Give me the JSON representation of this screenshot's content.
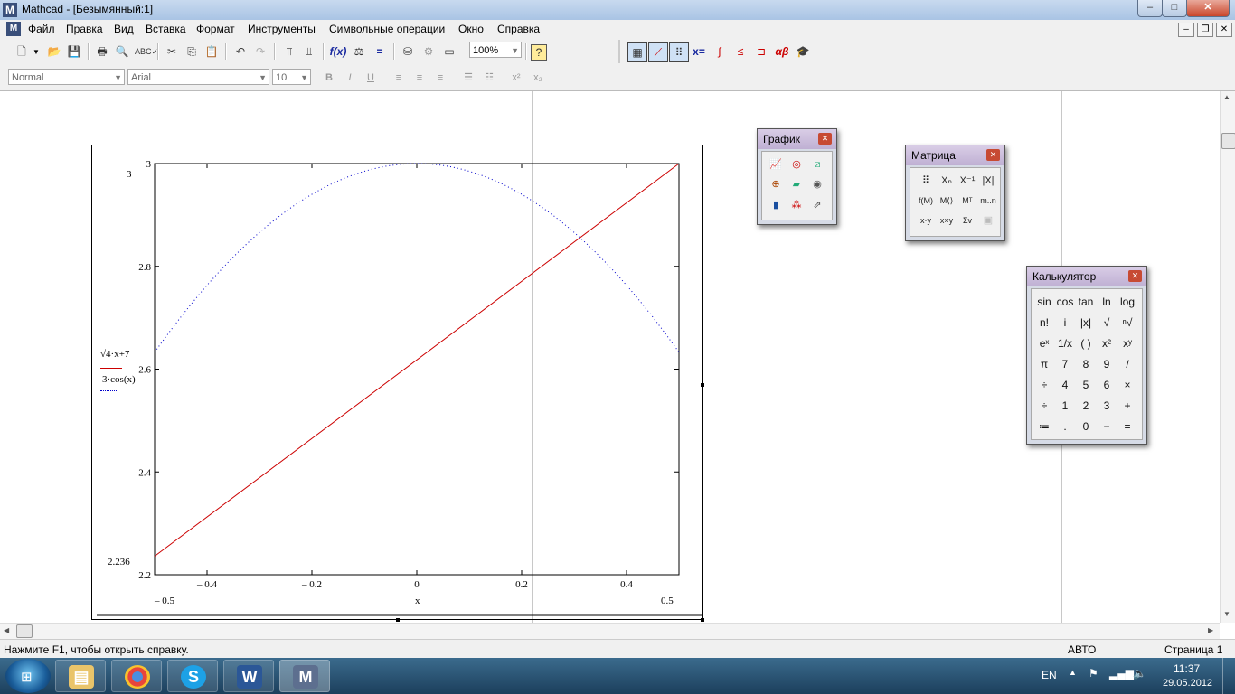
{
  "window": {
    "title": "Mathcad - [Безымянный:1]",
    "minimize": "–",
    "maximize": "□",
    "close": "✕"
  },
  "menu": [
    "Файл",
    "Правка",
    "Вид",
    "Вставка",
    "Формат",
    "Инструменты",
    "Символьные операции",
    "Окно",
    "Справка"
  ],
  "toolbar": {
    "zoom": "100%",
    "style": "Normal",
    "font": "Arial",
    "size": "10"
  },
  "plot": {
    "y_top_marker": "3",
    "y_bottom_marker": "2.236",
    "x_left_marker": "– 0.5",
    "x_right_marker": "0.5",
    "x_label": "x",
    "trace1_expr": "√4·x+7",
    "trace2_expr": "3·cos(x)",
    "x_ticks": [
      "– 0.4",
      "– 0.2",
      "0",
      "0.2",
      "0.4"
    ],
    "y_ticks": [
      "3",
      "2.8",
      "2.6",
      "2.4",
      "2.2"
    ]
  },
  "chart_data": {
    "type": "line",
    "title": "",
    "xlabel": "x",
    "ylabel": "",
    "xlim": [
      -0.5,
      0.5
    ],
    "ylim": [
      2.2,
      3.0
    ],
    "grid": false,
    "series": [
      {
        "name": "√4·x+7",
        "style": "solid",
        "color": "#cc0000",
        "x": [
          -0.5,
          0.5
        ],
        "y": [
          2.236,
          3.0
        ]
      },
      {
        "name": "3·cos(x)",
        "style": "dotted",
        "color": "#0000cc",
        "x": [
          -0.5,
          -0.4,
          -0.3,
          -0.2,
          -0.1,
          0,
          0.1,
          0.2,
          0.3,
          0.4,
          0.5
        ],
        "y": [
          2.633,
          2.763,
          2.866,
          2.94,
          2.985,
          3.0,
          2.985,
          2.94,
          2.866,
          2.763,
          2.633
        ]
      }
    ]
  },
  "palettes": {
    "graph": {
      "title": "График"
    },
    "matrix": {
      "title": "Матрица"
    },
    "calc": {
      "title": "Калькулятор",
      "rows": [
        [
          "sin",
          "cos",
          "tan",
          "ln",
          "log"
        ],
        [
          "n!",
          "i",
          "|x|",
          "√",
          "ⁿ√"
        ],
        [
          "eˣ",
          "1/x",
          "( )",
          "x²",
          "xʸ"
        ],
        [
          "π",
          "7",
          "8",
          "9",
          "/"
        ],
        [
          "÷",
          "4",
          "5",
          "6",
          "×"
        ],
        [
          "÷",
          "1",
          "2",
          "3",
          "+"
        ],
        [
          "≔",
          ".",
          "0",
          "−",
          "="
        ]
      ]
    }
  },
  "status": {
    "help": "Нажмите F1, чтобы открыть справку.",
    "mode": "АВТО",
    "page": "Страница 1"
  },
  "tray": {
    "lang": "EN",
    "time": "11:37",
    "date": "29.05.2012"
  },
  "colors": {
    "accent": "#cc0000",
    "secondary": "#0000cc"
  }
}
